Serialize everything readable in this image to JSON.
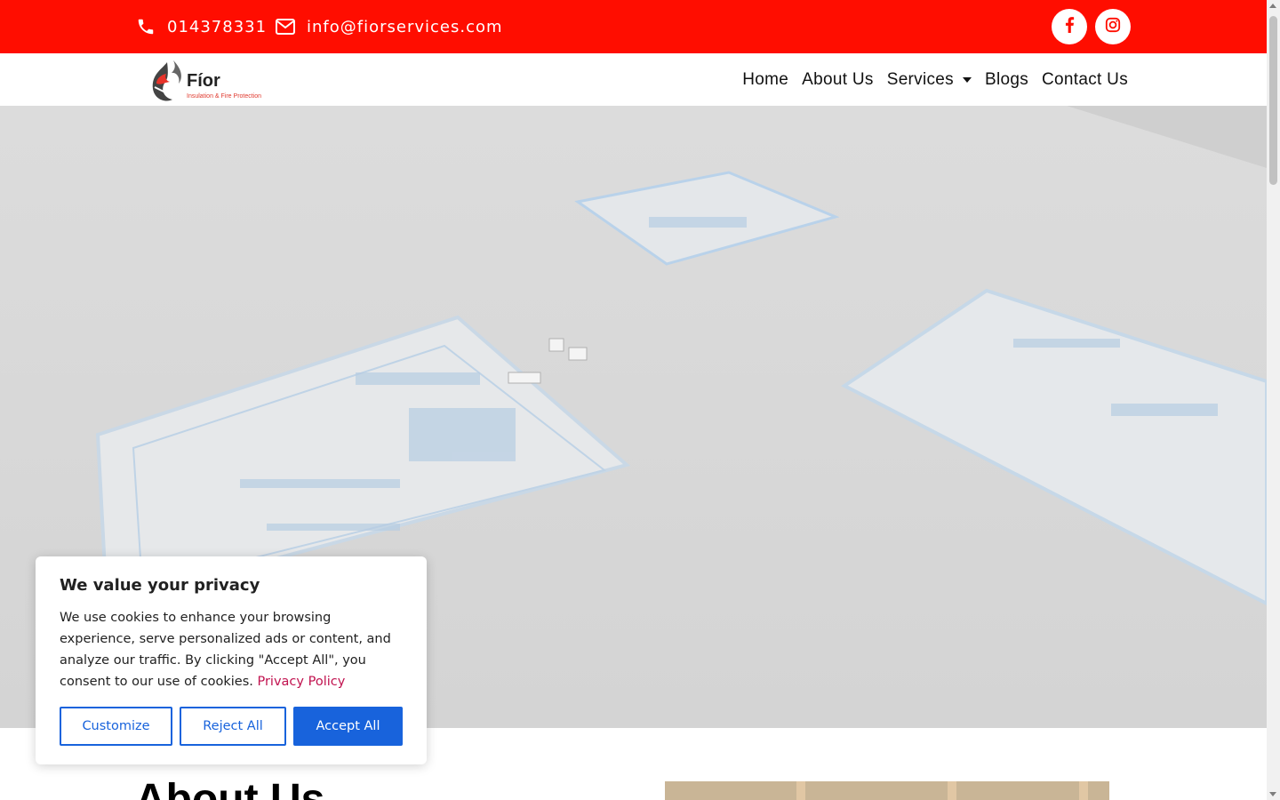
{
  "topbar": {
    "phone": "014378331",
    "email": "info@fiorservices.com",
    "icons": {
      "phone": "phone-icon",
      "email": "envelope-icon",
      "facebook": "facebook-icon",
      "instagram": "instagram-icon"
    }
  },
  "logo": {
    "name": "Fíor",
    "tagline": "Insulation & Fire Protection"
  },
  "nav": {
    "items": [
      "Home",
      "About Us",
      "Services",
      "Blogs",
      "Contact Us"
    ]
  },
  "about": {
    "title": "About Us"
  },
  "cookie": {
    "title": "We value your privacy",
    "body": "We use cookies to enhance your browsing experience, serve personalized ads or content, and analyze our traffic. By clicking \"Accept All\", you consent to our use of cookies. ",
    "link": "Privacy Policy",
    "customize": "Customize",
    "reject": "Reject All",
    "accept": "Accept All"
  },
  "colors": {
    "topbar": "#ff0d00",
    "primary_button": "#1863dc",
    "link": "#c1124f"
  }
}
